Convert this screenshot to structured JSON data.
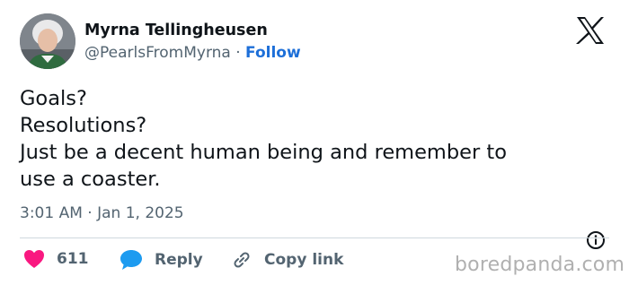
{
  "author": {
    "display_name": "Myrna Tellingheusen",
    "handle": "@PearlsFromMyrna",
    "separator": "·",
    "follow_label": "Follow"
  },
  "tweet": {
    "lines": [
      "Goals?",
      "Resolutions?",
      "Just be a decent human being and remember to",
      "use a coaster."
    ],
    "timestamp": "3:01 AM · Jan 1, 2025"
  },
  "actions": {
    "like_count": "611",
    "reply_label": "Reply",
    "copy_link_label": "Copy link"
  },
  "watermark": "boredpanda.com",
  "icons": {
    "logo": "x-logo-icon",
    "like": "heart-icon",
    "reply": "speech-bubble-icon",
    "copy": "link-icon",
    "info": "info-icon"
  },
  "colors": {
    "follow": "#1d6fd8",
    "heart": "#f91880",
    "reply_bubble": "#1d9bf0",
    "text": "#0f1419",
    "muted": "#536471"
  }
}
